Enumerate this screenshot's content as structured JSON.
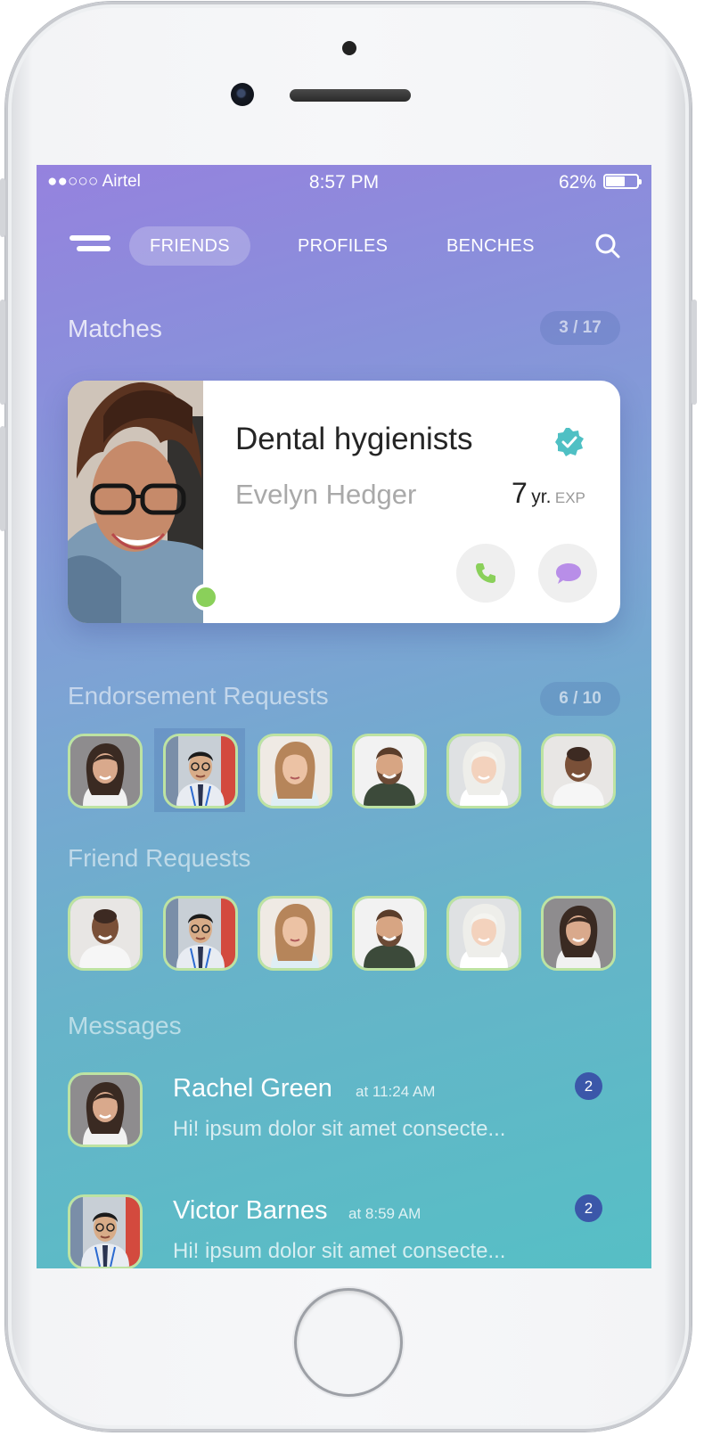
{
  "status_bar": {
    "carrier": "●●○○○ Airtel",
    "time": "8:57 PM",
    "battery_percent": "62%",
    "battery_level": 0.62
  },
  "nav": {
    "menu_icon": "hamburger-icon",
    "tabs": [
      {
        "label": "FRIENDS",
        "active": true
      },
      {
        "label": "PROFILES",
        "active": false
      },
      {
        "label": "BENCHES",
        "active": false
      }
    ],
    "search_icon": "search-icon"
  },
  "matches": {
    "title": "Matches",
    "counter": "3 / 17",
    "card": {
      "title": "Dental hygienists",
      "name": "Evelyn Hedger",
      "exp_number": "7",
      "exp_unit": "yr.",
      "exp_label": "EXP",
      "verified_icon": "verified-badge-icon",
      "online": true,
      "call_icon": "phone-icon",
      "message_icon": "chat-bubble-icon"
    }
  },
  "endorsements": {
    "title": "Endorsement Requests",
    "counter": "6 / 10"
  },
  "friend_requests": {
    "title": "Friend Requests"
  },
  "messages": {
    "title": "Messages",
    "items": [
      {
        "name": "Rachel Green",
        "time": "at 11:24 AM",
        "preview": "Hi! ipsum dolor sit amet consecte...",
        "badge": "2"
      },
      {
        "name": "Victor Barnes",
        "time": "at 8:59 AM",
        "preview": "Hi! ipsum dolor sit amet consecte...",
        "badge": "2"
      }
    ]
  },
  "colors": {
    "gradient_top": "#9582de",
    "gradient_bottom": "#56bfc5",
    "online_green": "#8ad05a",
    "verified_teal": "#4fc0c4",
    "badge_blue": "#3b57a9",
    "avatar_border": "#bde3a2"
  }
}
